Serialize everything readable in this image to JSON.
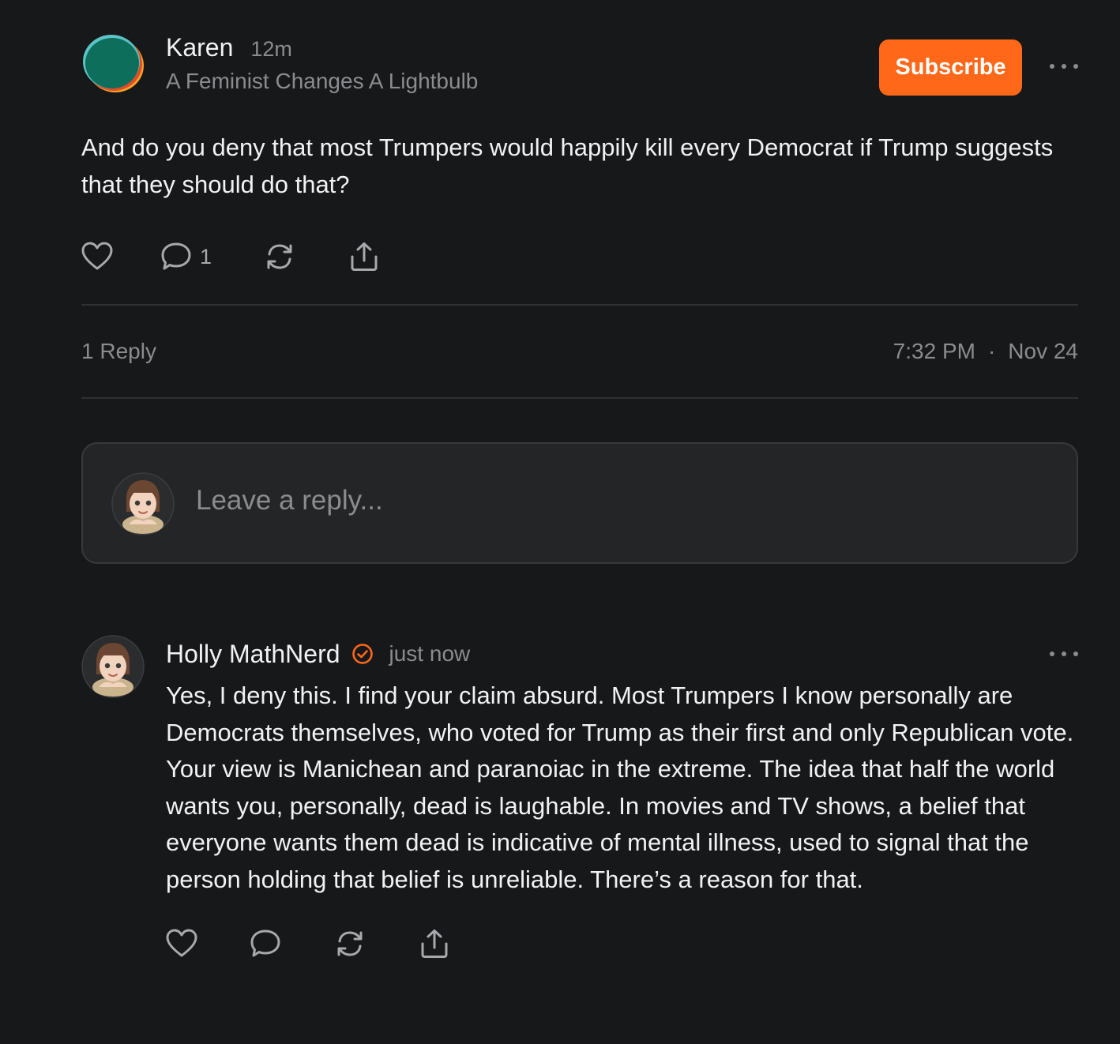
{
  "post": {
    "author": "Karen",
    "time_ago": "12m",
    "publication": "A Feminist Changes A Lightbulb",
    "subscribe_label": "Subscribe",
    "body": "And do you deny that most Trumpers would happily kill every Democrat if Trump suggests that they should do that?",
    "comment_count": "1",
    "replies_label": "1 Reply",
    "time": "7:32 PM",
    "separator": "·",
    "date": "Nov 24"
  },
  "reply_box": {
    "placeholder": "Leave a reply..."
  },
  "comment": {
    "author": "Holly MathNerd",
    "time_ago": "just now",
    "body": "Yes, I deny this. I find your claim absurd. Most Trumpers I know personally are Democrats themselves, who voted for Trump as their first and only Republican vote. Your view is Manichean and paranoiac in the extreme. The idea that half the world wants you, personally, dead is laughable. In movies and TV shows, a belief that everyone wants them dead is indicative of mental illness, used to signal that the person holding that belief is unreliable. There’s a reason for that."
  },
  "icons": {
    "like": "heart-icon",
    "comment": "comment-bubble-icon",
    "restack": "restack-icon",
    "share": "share-icon",
    "more": "more-dots-icon",
    "verified": "verified-check-icon"
  },
  "colors": {
    "background": "#17181a",
    "accent": "#ff6719",
    "text": "#f2f2f2",
    "muted": "#8b8c8f"
  }
}
